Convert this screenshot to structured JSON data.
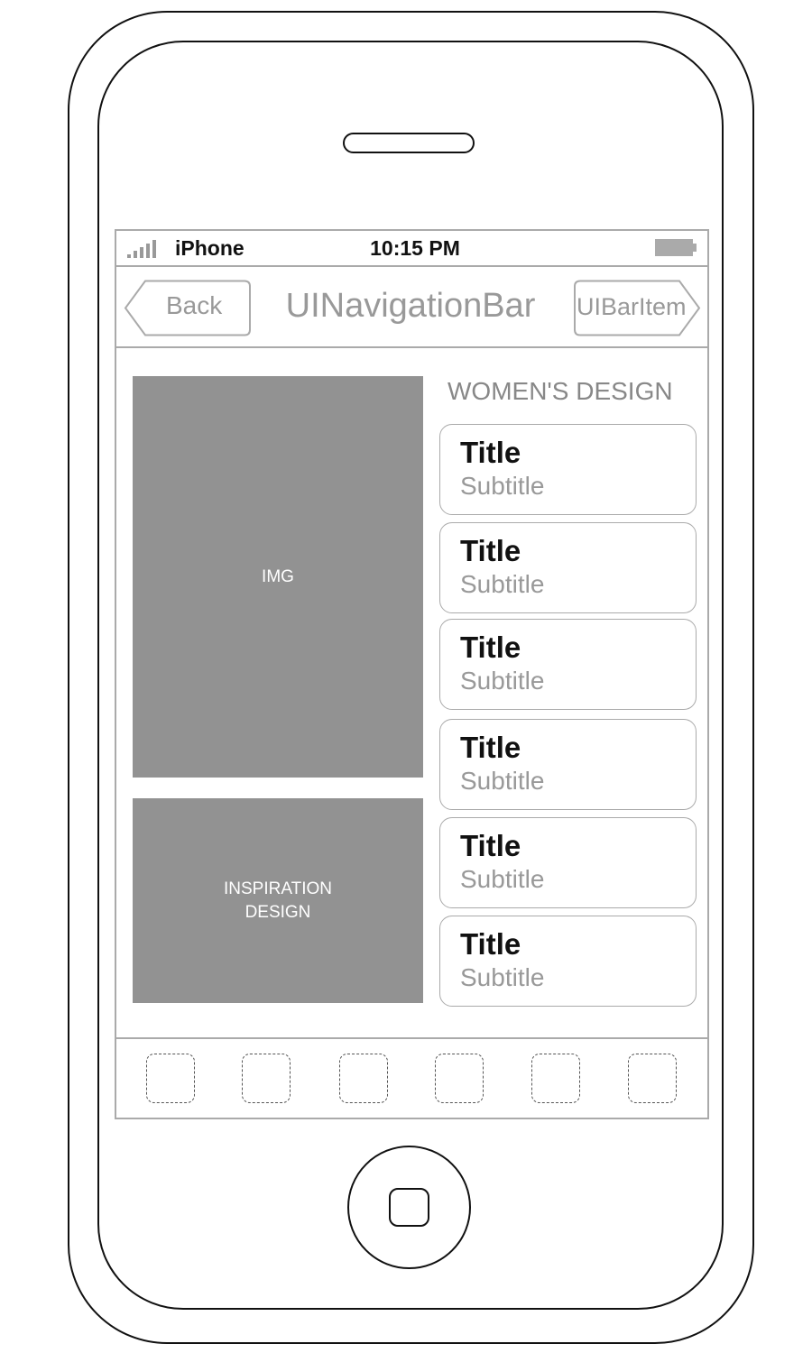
{
  "status_bar": {
    "carrier": "iPhone",
    "time": "10:15 PM",
    "signal_icon": "signal-bars-icon",
    "battery_icon": "battery-icon"
  },
  "nav_bar": {
    "back_label": "Back",
    "title": "UINavigationBar",
    "right_item_label": "UIBarItem"
  },
  "content": {
    "heading": "WOMEN'S DESIGN",
    "image_main_label": "IMG",
    "image_secondary_label": "INSPIRATION\nDESIGN",
    "cards": [
      {
        "title": "Title",
        "subtitle": "Subtitle"
      },
      {
        "title": "Title",
        "subtitle": "Subtitle"
      },
      {
        "title": "Title",
        "subtitle": "Subtitle"
      },
      {
        "title": "Title",
        "subtitle": "Subtitle"
      },
      {
        "title": "Title",
        "subtitle": "Subtitle"
      },
      {
        "title": "Title",
        "subtitle": "Subtitle"
      }
    ]
  },
  "tab_bar": {
    "items": [
      "placeholder-icon",
      "placeholder-icon",
      "placeholder-icon",
      "placeholder-icon",
      "placeholder-icon",
      "placeholder-icon"
    ]
  },
  "colors": {
    "image_fill": "#929292",
    "wire_gray": "#aaaaaa",
    "outline": "#111111"
  }
}
